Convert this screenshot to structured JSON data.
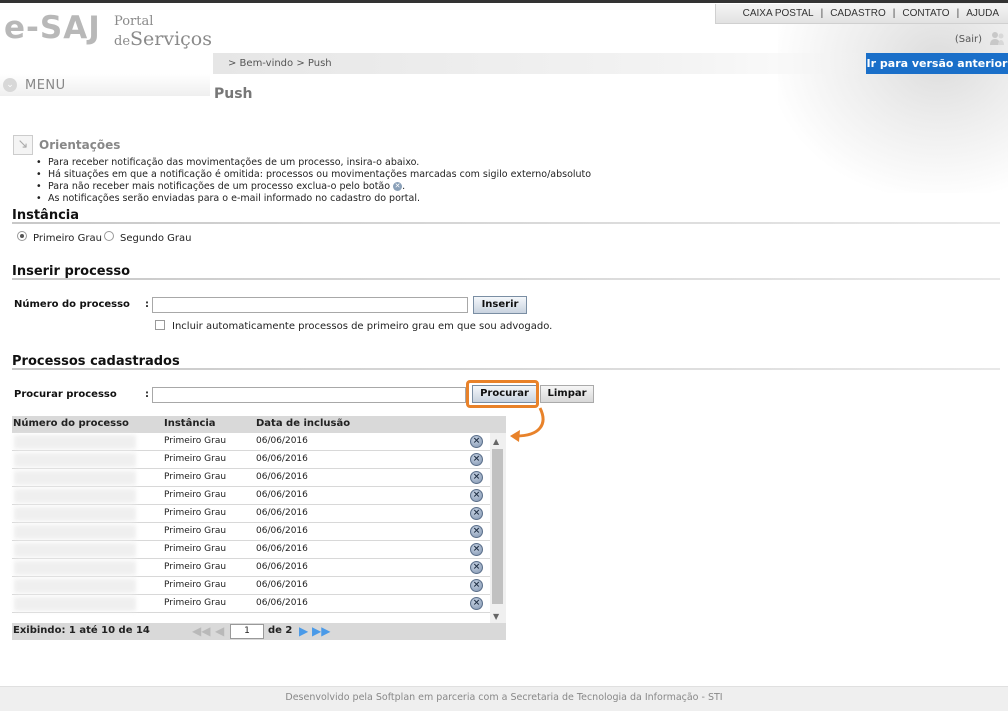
{
  "header": {
    "logo_main": "e-SAJ",
    "logo_sub1": "Portal",
    "logo_sub2_prefix": "de",
    "logo_sub2": "Serviços",
    "top_nav": [
      "CAIXA POSTAL",
      "CADASTRO",
      "CONTATO",
      "AJUDA"
    ],
    "logout": "(Sair)",
    "previous_version_button": "Ir para versão anterior"
  },
  "breadcrumb": "> Bem-vindo > Push",
  "menu_label": "MENU",
  "page_title": "Push",
  "orientacoes": {
    "title": "Orientações",
    "items": [
      "Para receber notificação das movimentações de um processo, insira-o abaixo.",
      "Há situações em que a notificação é omitida: processos ou movimentações marcadas com sigilo externo/absoluto",
      "Para não receber mais notificações de um processo exclua-o pelo botão",
      "As notificações serão enviadas para o e-mail informado no cadastro do portal."
    ]
  },
  "instancia": {
    "title": "Instância",
    "options": [
      "Primeiro Grau",
      "Segundo Grau"
    ],
    "selected": "Primeiro Grau"
  },
  "inserir": {
    "title": "Inserir processo",
    "field_label": "Número do processo",
    "colon": ":",
    "value": "",
    "button": "Inserir",
    "checkbox_label": "Incluir automaticamente processos de primeiro grau em que sou advogado.",
    "checkbox_checked": false
  },
  "cadastrados": {
    "title": "Processos cadastrados",
    "search_label": "Procurar processo",
    "colon": ":",
    "search_value": "",
    "search_button": "Procurar",
    "clear_button": "Limpar",
    "columns": [
      "Número do processo",
      "Instância",
      "Data de inclusão"
    ],
    "rows": [
      {
        "instancia": "Primeiro Grau",
        "data": "06/06/2016"
      },
      {
        "instancia": "Primeiro Grau",
        "data": "06/06/2016"
      },
      {
        "instancia": "Primeiro Grau",
        "data": "06/06/2016"
      },
      {
        "instancia": "Primeiro Grau",
        "data": "06/06/2016"
      },
      {
        "instancia": "Primeiro Grau",
        "data": "06/06/2016"
      },
      {
        "instancia": "Primeiro Grau",
        "data": "06/06/2016"
      },
      {
        "instancia": "Primeiro Grau",
        "data": "06/06/2016"
      },
      {
        "instancia": "Primeiro Grau",
        "data": "06/06/2016"
      },
      {
        "instancia": "Primeiro Grau",
        "data": "06/06/2016"
      },
      {
        "instancia": "Primeiro Grau",
        "data": "06/06/2016"
      }
    ],
    "pagination": {
      "showing": "Exibindo: 1 até 10 de 14",
      "current_page": "1",
      "of_pages": "de 2"
    }
  },
  "footer": "Desenvolvido pela Softplan em parceria com a Secretaria de Tecnologia da Informação - STI",
  "colors": {
    "accent_blue": "#1a6fc9",
    "highlight_orange": "#e8822a"
  },
  "icons": {
    "remove": "remove-circle-icon",
    "user": "user-icon",
    "menu": "chevron-down-icon",
    "orientacoes": "arrow-icon"
  }
}
